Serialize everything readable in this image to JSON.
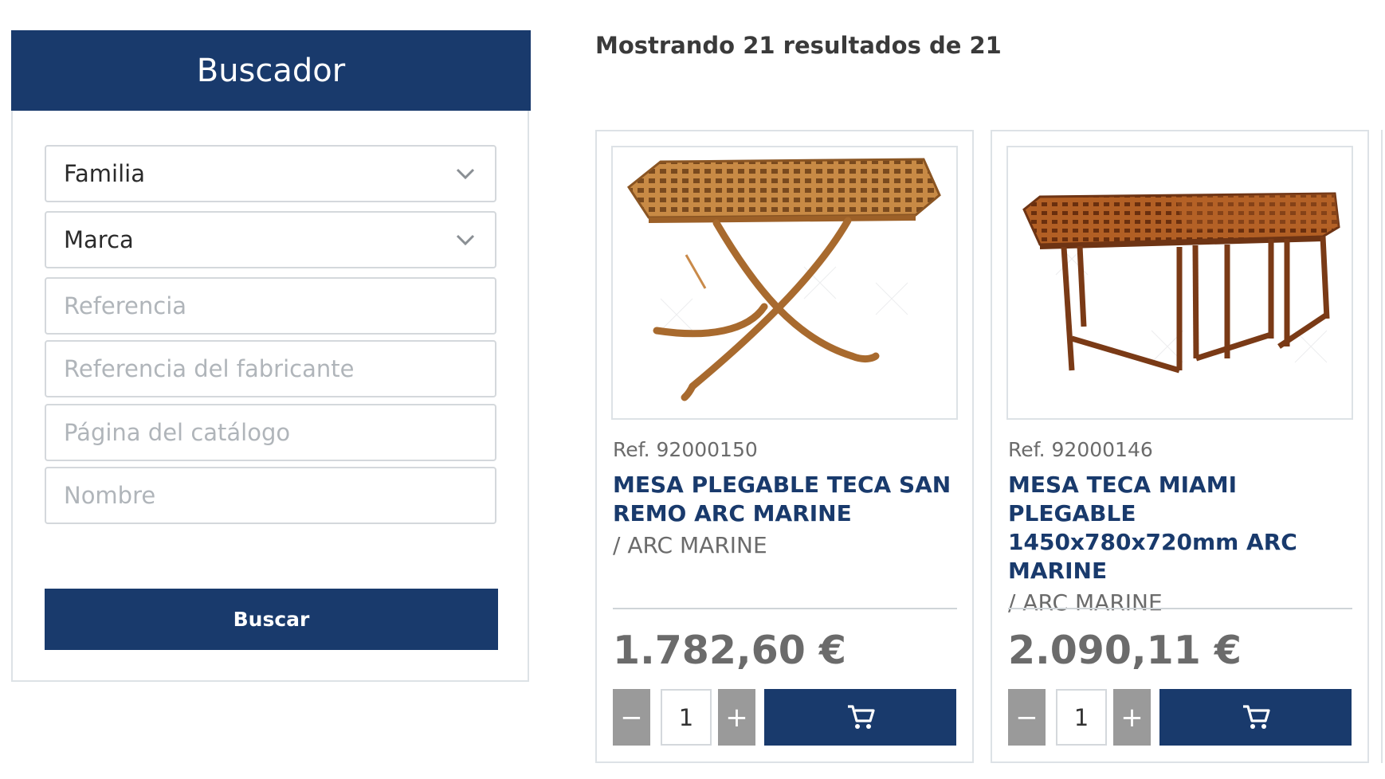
{
  "sidebar": {
    "title": "Buscador",
    "family_select": "Familia",
    "brand_select": "Marca",
    "reference_placeholder": "Referencia",
    "manufacturer_ref_placeholder": "Referencia del fabricante",
    "catalog_page_placeholder": "Página del catálogo",
    "name_placeholder": "Nombre",
    "search_button": "Buscar"
  },
  "results": {
    "count_text": "Mostrando 21 resultados de 21"
  },
  "products": [
    {
      "ref": "Ref. 92000150",
      "title": "MESA PLEGABLE TECA SAN REMO ARC MARINE",
      "brand": "/ ARC MARINE",
      "price": "1.782,60 €",
      "quantity": "1",
      "minus_label": "−",
      "plus_label": "+"
    },
    {
      "ref": "Ref. 92000146",
      "title": "MESA TECA MIAMI PLEGABLE 1450x780x720mm ARC MARINE",
      "brand": "/ ARC MARINE",
      "price": "2.090,11 €",
      "quantity": "1",
      "minus_label": "−",
      "plus_label": "+"
    }
  ],
  "icons": {
    "chevron": "chevron-down-icon",
    "cart": "cart-icon"
  },
  "colors": {
    "primary": "#193a6c",
    "title_blue": "#193a6c",
    "grey_button": "#9a9a9a",
    "border": "#dde2e6"
  }
}
